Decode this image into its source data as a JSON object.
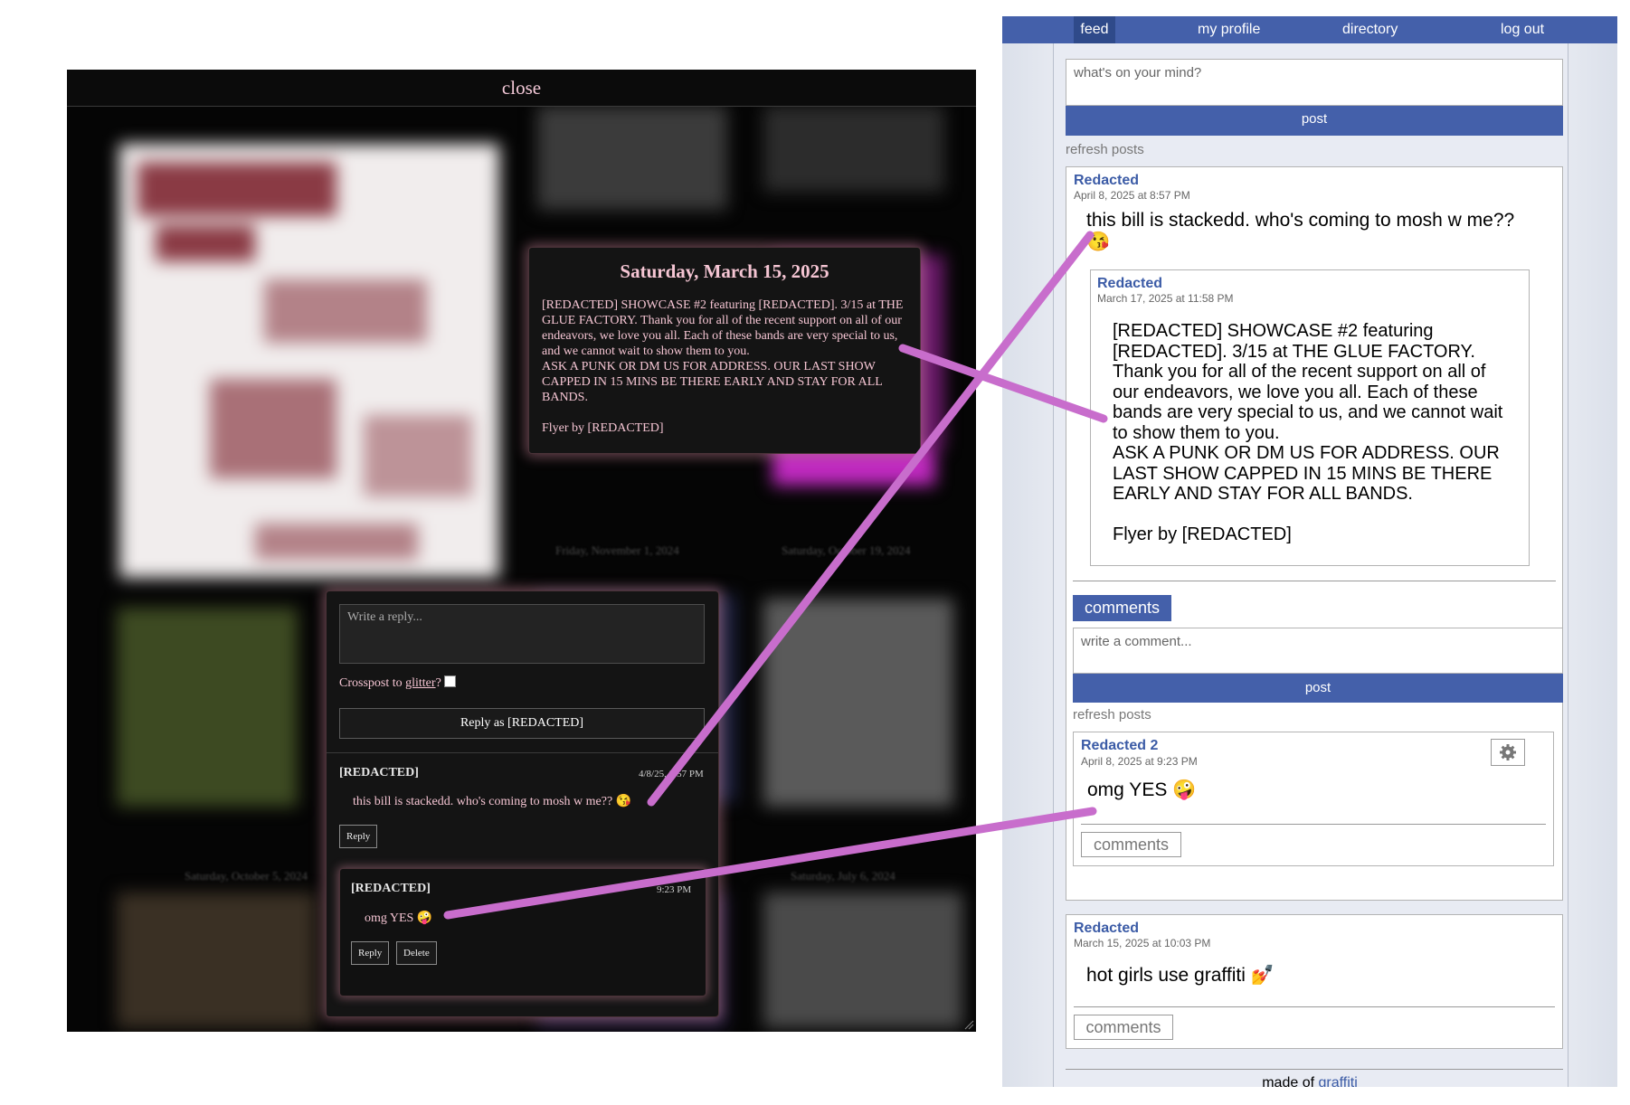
{
  "left": {
    "close_label": "close",
    "background_dates": [
      "Friday, November 1, 2024",
      "Saturday, October 19, 2024",
      "Saturday, October 5, 2024",
      "Saturday, July 6, 2024"
    ],
    "flyer_text": "OUT FOR A RIP",
    "post_popup": {
      "date": "Saturday, March 15, 2025",
      "body": "[REDACTED] SHOWCASE #2 featuring [REDACTED]. 3/15 at THE GLUE FACTORY. Thank you for all of the recent support on all of our endeavors, we love you all. Each of these bands are very special to us, and we cannot wait to show them to you.\nASK A PUNK OR DM US FOR ADDRESS. OUR LAST SHOW CAPPED IN 15 MINS BE THERE EARLY AND STAY FOR ALL BANDS.\n\nFlyer by [REDACTED]"
    },
    "reply_box": {
      "placeholder": "Write a reply...",
      "crosspost_prefix": "Crosspost to ",
      "crosspost_link": "glitter",
      "crosspost_suffix": "?",
      "reply_as_label": "Reply as [REDACTED]"
    },
    "comment": {
      "author": "[REDACTED]",
      "time": "4/8/25, 8:57 PM",
      "text": "this bill is stackedd. who's coming to mosh w me?? 😘",
      "reply_label": "Reply"
    },
    "nested_comment": {
      "author": "[REDACTED]",
      "time": "9:23 PM",
      "text": "omg YES 🤪",
      "reply_label": "Reply",
      "delete_label": "Delete"
    }
  },
  "right": {
    "nav": {
      "items": [
        "feed",
        "my profile",
        "directory",
        "log out"
      ],
      "active": "feed"
    },
    "status_placeholder": "what's on your mind?",
    "post_label": "post",
    "refresh_label": "refresh posts",
    "post1": {
      "author": "Redacted",
      "timestamp": "April 8, 2025 at 8:57 PM",
      "text": "this bill is stackedd. who's coming to mosh w me?? 😘",
      "quoted": {
        "author": "Redacted",
        "timestamp": "March 17, 2025 at 11:58 PM",
        "text": "[REDACTED] SHOWCASE #2 featuring [REDACTED]. 3/15 at THE GLUE FACTORY. Thank you for all of the recent support on all of our endeavors, we love you all. Each of these bands are very special to us, and we cannot wait to show them to you.\nASK A PUNK OR DM US FOR ADDRESS. OUR LAST SHOW CAPPED IN 15 MINS BE THERE EARLY AND STAY FOR ALL BANDS.\n\nFlyer by [REDACTED]"
      },
      "comments_label": "comments",
      "comment_placeholder": "write a comment...",
      "comment_post_label": "post",
      "comment_refresh_label": "refresh posts",
      "reply": {
        "author": "Redacted 2",
        "timestamp": "April 8, 2025 at 9:23 PM",
        "text": "omg YES 🤪",
        "comments_label": "comments"
      }
    },
    "post2": {
      "author": "Redacted",
      "timestamp": "March 15, 2025 at 10:03 PM",
      "text": "hot girls use graffiti 💅",
      "comments_label": "comments"
    },
    "footer": {
      "prefix": "made of ",
      "link": "graffiti"
    }
  },
  "colors": {
    "nav_blue": "#4460aa",
    "link_blue": "#3b5ba6",
    "pink_text": "#f5c5d3",
    "annotation_line": "#c86dcc"
  }
}
